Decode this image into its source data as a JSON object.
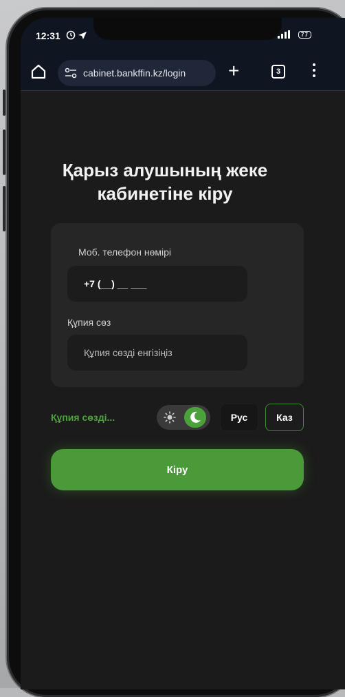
{
  "status_bar": {
    "time": "12:31",
    "battery": "77",
    "signal": "4G"
  },
  "browser": {
    "url": "cabinet.bankffin.kz/login",
    "tab_count": "3"
  },
  "page": {
    "title": "Қарыз алушының жеке кабинетіне кіру",
    "phone_label": "Моб. телефон нөмірі",
    "phone_value": "+7 (__) __ ___",
    "password_label": "Құпия сөз",
    "password_placeholder": "Құпия сөзді енгізіңіз",
    "forgot_link": "Құпия сөзді...",
    "lang_ru": "Рус",
    "lang_kz": "Каз",
    "submit_label": "Кіру",
    "theme": "dark"
  },
  "colors": {
    "accent": "#4a9a39",
    "background": "#1b1b1b",
    "card": "#262626",
    "browser_bar": "#101522"
  }
}
